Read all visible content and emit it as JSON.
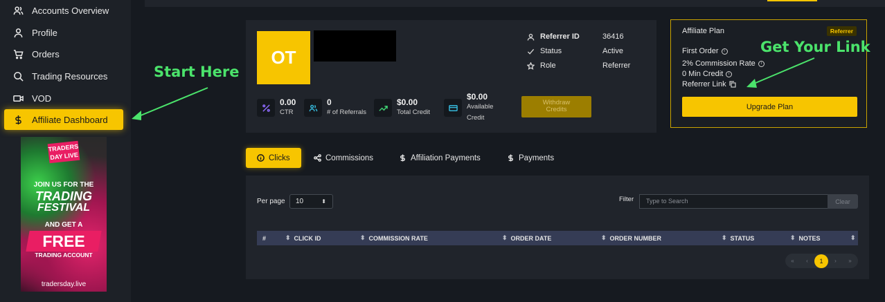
{
  "sidebar": {
    "items": [
      {
        "label": "Accounts Overview",
        "icon": "users-icon"
      },
      {
        "label": "Profile",
        "icon": "user-icon"
      },
      {
        "label": "Orders",
        "icon": "cart-icon"
      },
      {
        "label": "Trading Resources",
        "icon": "search-icon"
      },
      {
        "label": "VOD",
        "icon": "video-icon"
      },
      {
        "label": "Affiliate Dashboard",
        "icon": "dollar-icon",
        "active": true
      }
    ],
    "promo": {
      "logo": "TRADERS DAY LIVE",
      "line1": "JOIN US FOR THE",
      "line2": "TRADING",
      "line3": "FESTIVAL",
      "line4": "AND GET A",
      "line5": "FREE",
      "line6": "TRADING ACCOUNT",
      "url": "tradersday.live"
    }
  },
  "profile": {
    "initials": "OT",
    "referrer_id_label": "Referrer ID",
    "referrer_id": "36416",
    "status_label": "Status",
    "status": "Active",
    "role_label": "Role",
    "role": "Referrer",
    "stats": {
      "ctr_value": "0.00",
      "ctr_label": "CTR",
      "referrals_value": "0",
      "referrals_label": "# of Referrals",
      "total_credit_value": "$0.00",
      "total_credit_label": "Total Credit",
      "available_credit_value": "$0.00",
      "available_credit_label_1": "Available",
      "available_credit_label_2": "Credit"
    },
    "withdraw_label_1": "Withdraw",
    "withdraw_label_2": "Credits"
  },
  "plan": {
    "title": "Affiliate Plan",
    "badge": "Referrer",
    "first_order": "First Order",
    "commission": "2% Commission Rate",
    "min_credit": "0 Min Credit",
    "referrer_link": "Referrer Link",
    "upgrade": "Upgrade Plan"
  },
  "annotations": {
    "start": "Start Here",
    "link": "Get Your Link",
    "color": "#4be36b"
  },
  "tabs": [
    {
      "label": "Clicks",
      "icon": "info-icon",
      "active": true
    },
    {
      "label": "Commissions",
      "icon": "share-icon"
    },
    {
      "label": "Affiliation Payments",
      "icon": "dollar-icon"
    },
    {
      "label": "Payments",
      "icon": "dollar-icon"
    }
  ],
  "table": {
    "per_page_label": "Per page",
    "per_page_value": "10",
    "filter_label": "Filter",
    "search_placeholder": "Type to Search",
    "clear_label": "Clear",
    "columns": [
      "#",
      "CLICK ID",
      "COMMISSION RATE",
      "ORDER DATE",
      "ORDER NUMBER",
      "STATUS",
      "NOTES"
    ],
    "pager": {
      "first": "«",
      "prev": "‹",
      "current": "1",
      "next": "›",
      "last": "»"
    }
  },
  "colors": {
    "accent": "#f7c500",
    "bg": "#161a20",
    "panel": "#20242b",
    "annotation": "#4be36b"
  }
}
